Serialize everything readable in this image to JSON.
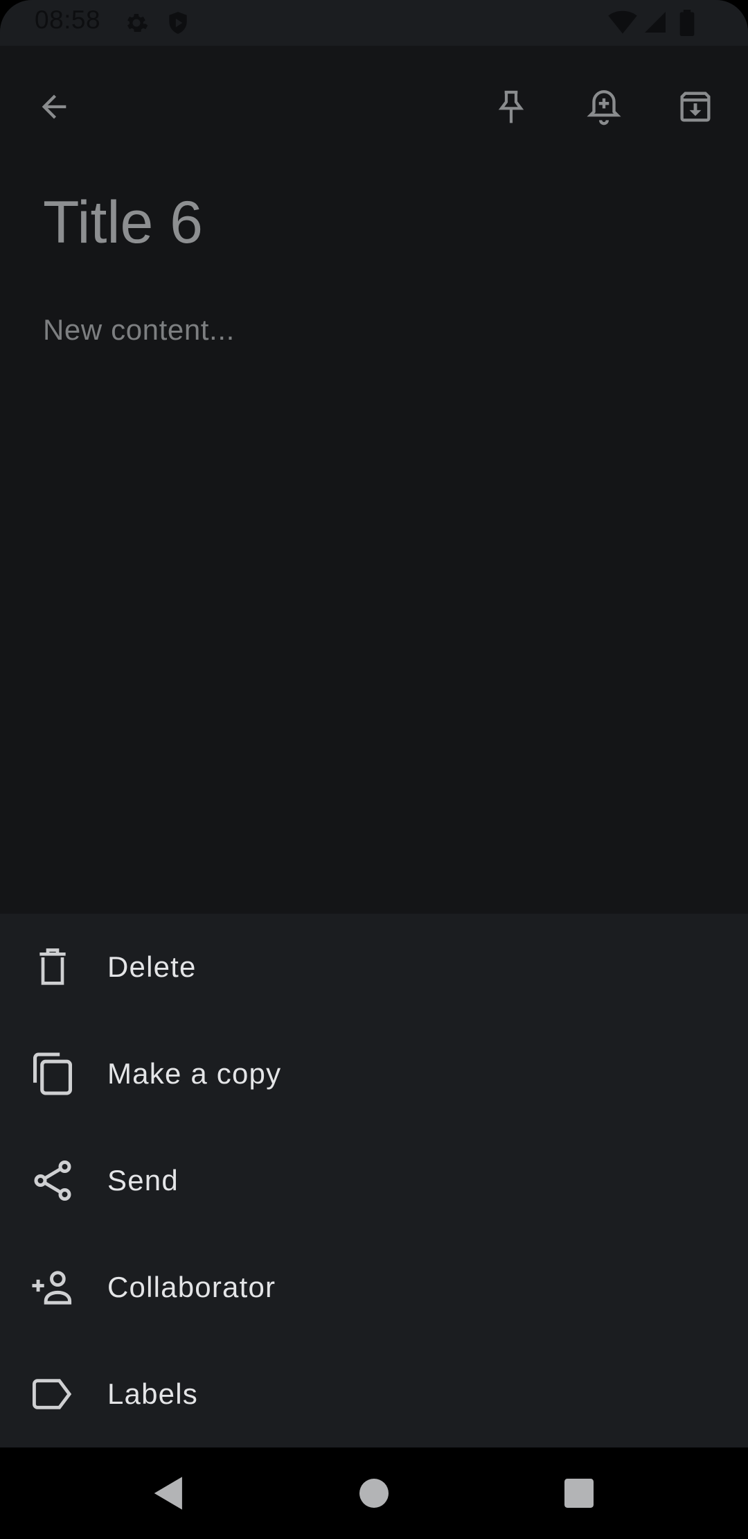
{
  "status_bar": {
    "time": "08:58",
    "icons": [
      "settings-icon",
      "shield-play-icon",
      "wifi-icon",
      "signal-icon",
      "battery-icon"
    ]
  },
  "toolbar": {
    "icons": [
      "back-arrow-icon",
      "pin-icon",
      "add-reminder-icon",
      "archive-icon"
    ]
  },
  "note": {
    "title": "Title 6",
    "content": "New content..."
  },
  "menu": {
    "items": [
      {
        "label": "Delete",
        "icon": "trash-icon"
      },
      {
        "label": "Make a copy",
        "icon": "copy-icon"
      },
      {
        "label": "Send",
        "icon": "share-icon"
      },
      {
        "label": "Collaborator",
        "icon": "add-person-icon"
      },
      {
        "label": "Labels",
        "icon": "label-icon"
      }
    ]
  },
  "navigation": {
    "icons": [
      "nav-back-icon",
      "nav-home-icon",
      "nav-recents-icon"
    ]
  },
  "colors": {
    "background": "#141517",
    "sheet": "#1b1d20",
    "menu_text": "#e4e5e7",
    "title_text": "#8d8f91"
  }
}
